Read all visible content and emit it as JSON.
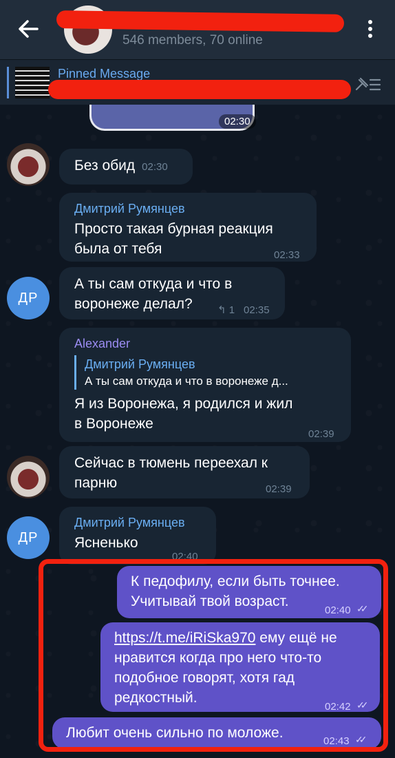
{
  "header": {
    "subtitle": "546 members, 70 online"
  },
  "pinned": {
    "label": "Pinned Message"
  },
  "sticker": {
    "time": "02:30"
  },
  "messages": [
    {
      "sender": "",
      "text": "Без обид",
      "time": "02:30"
    },
    {
      "sender": "Дмитрий Румянцев",
      "text_1": "Просто такая бурная реакция",
      "text_2": "была от тебя",
      "time": "02:33"
    },
    {
      "avatar_initials": "ДР",
      "text_1": "А ты сам откуда и что в",
      "text_2": "воронеже делал?",
      "replies": "↰ 1",
      "time": "02:35"
    },
    {
      "sender": "Alexander",
      "reply_name": "Дмитрий Румянцев",
      "reply_text": "А ты сам откуда и что в воронеже д...",
      "text_1": "Я из Воронежа, я родился и жил",
      "text_2": "в Воронеже",
      "time": "02:39"
    },
    {
      "text_1": "Сейчас в тюмень переехал к",
      "text_2": "парню",
      "time": "02:39"
    },
    {
      "avatar_initials": "ДР",
      "sender": "Дмитрий Румянцев",
      "text": "Ясненько",
      "time": "02:40"
    }
  ],
  "outgoing": [
    {
      "text_1": "К педофилу, если быть точнее.",
      "text_2": "Учитывай твой возраст.",
      "time": "02:40"
    },
    {
      "link": "https://t.me/iRiSka970",
      "text_1": " ему ещё не",
      "text_2": "нравится  когда про него что-то",
      "text_3": "подобное говорят, хотя гад",
      "text_4": "редкостный.",
      "time": "02:42"
    },
    {
      "text": "Любит очень сильно по моложе.",
      "time": "02:43"
    }
  ],
  "colors": {
    "header_bg": "#212d3b",
    "chat_bg": "#0e1621",
    "incoming_bubble": "#182533",
    "outgoing_bubble": "#5f52c8",
    "sender_blue": "#6aaef2",
    "sender_purple": "#9b8cf2",
    "annotation_red": "#f2210f"
  }
}
